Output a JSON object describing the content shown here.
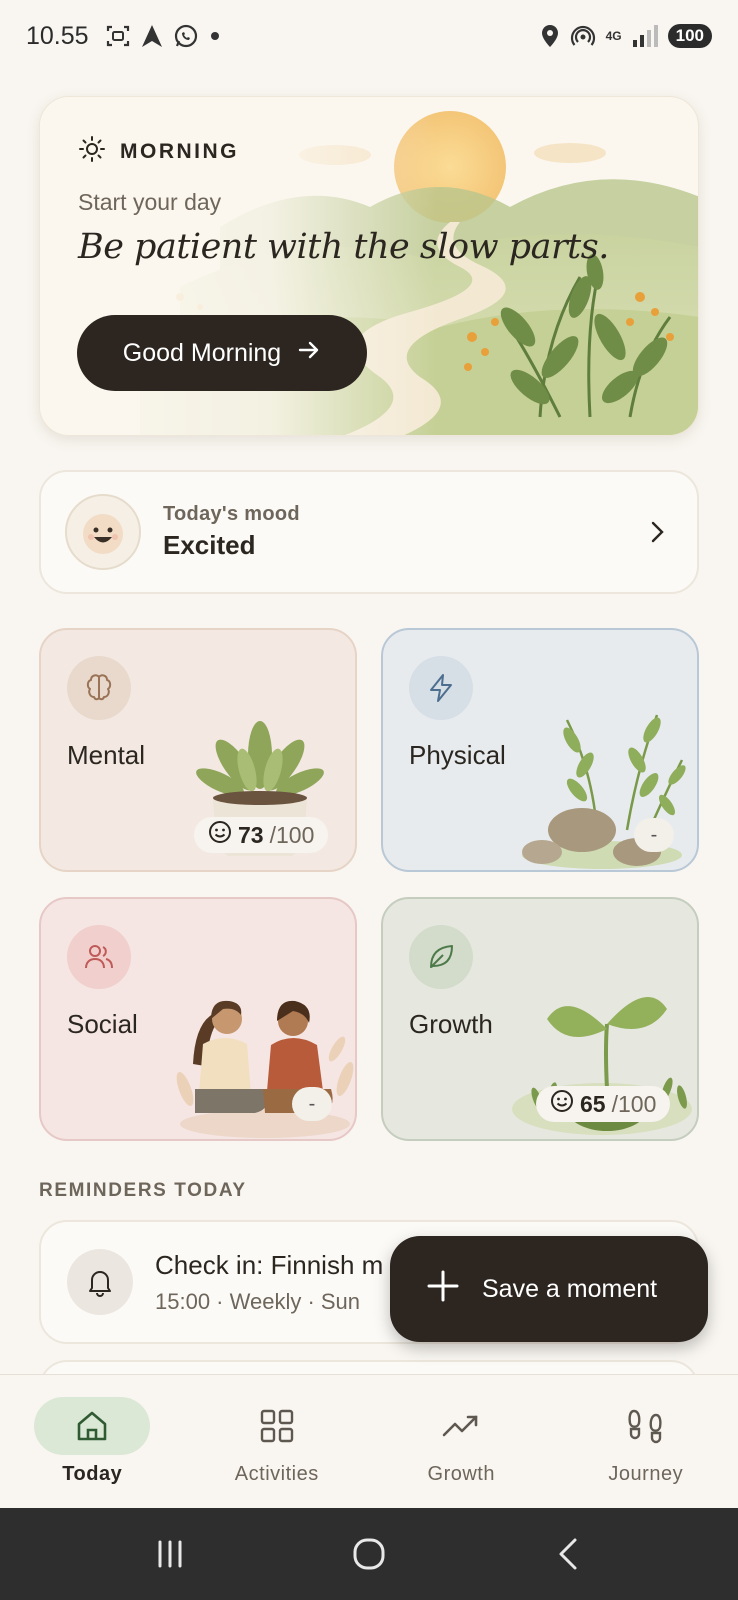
{
  "status_bar": {
    "time": "10.55",
    "network": "4G",
    "battery": "100"
  },
  "hero": {
    "label": "MORNING",
    "subtitle": "Start your day",
    "quote": "Be patient with the slow parts.",
    "button_label": "Good Morning",
    "icons": [
      "sun-icon",
      "arrow-right-icon"
    ]
  },
  "mood": {
    "label": "Today's mood",
    "value": "Excited",
    "icon": "excited-face-icon"
  },
  "categories": [
    {
      "title": "Mental",
      "icon": "brain-icon",
      "score": "73",
      "max": "/100",
      "color": "#f3e9e2"
    },
    {
      "title": "Physical",
      "icon": "lightning-icon",
      "score": "-",
      "color": "#e8ebee"
    },
    {
      "title": "Social",
      "icon": "users-icon",
      "score": "-",
      "color": "#f5e5e3"
    },
    {
      "title": "Growth",
      "icon": "leaf-icon",
      "score": "65",
      "max": "/100",
      "color": "#e6e8e0"
    }
  ],
  "reminders": {
    "section_title": "REMINDERS TODAY",
    "items": [
      {
        "title": "Check in: Finnish m",
        "meta": "15:00 · Weekly · Sun"
      }
    ]
  },
  "fab": {
    "label": "Save a moment"
  },
  "nav": {
    "items": [
      {
        "label": "Today",
        "icon": "home-icon",
        "active": true
      },
      {
        "label": "Activities",
        "icon": "grid-icon",
        "active": false
      },
      {
        "label": "Growth",
        "icon": "trending-up-icon",
        "active": false
      },
      {
        "label": "Journey",
        "icon": "footprints-icon",
        "active": false
      }
    ]
  },
  "colors": {
    "background": "#f9f6f1",
    "dark_button": "#2c2520",
    "nav_active": "#dce8d6"
  }
}
